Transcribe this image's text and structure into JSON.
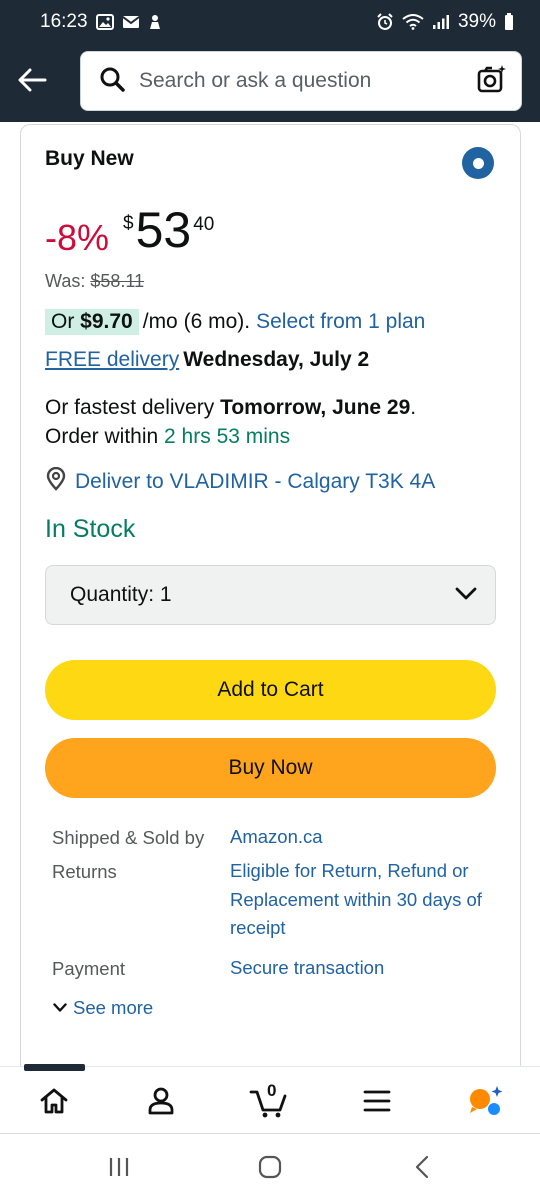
{
  "status_bar": {
    "time": "16:23",
    "battery": "39%"
  },
  "search": {
    "placeholder": "Search or ask a question"
  },
  "buy_box": {
    "title": "Buy New",
    "discount": "-8%",
    "currency": "$",
    "price_whole": "53",
    "price_fraction": "40",
    "was_label": "Was:",
    "was_price": "$58.11",
    "installment_prefix": "Or",
    "installment_amount": "$9.70",
    "installment_suffix": "/mo (6 mo).",
    "installment_link": "Select from 1 plan",
    "free_delivery_link": "FREE delivery",
    "delivery_date": "Wednesday, July 2",
    "fastest_prefix": "Or fastest delivery",
    "fastest_date": "Tomorrow, June 29",
    "fastest_period": ".",
    "order_within_label": "Order within",
    "order_within_time": "2 hrs 53 mins",
    "deliver_to": "Deliver to VLADIMIR - Calgary T3K 4A",
    "stock_status": "In Stock",
    "quantity_label": "Quantity:",
    "quantity_value": "1",
    "add_to_cart": "Add to Cart",
    "buy_now": "Buy Now",
    "shipped_label": "Shipped & Sold by",
    "shipped_value": "Amazon.ca",
    "returns_label": "Returns",
    "returns_value": "Eligible for Return, Refund or Replacement within 30 days of receipt",
    "payment_label": "Payment",
    "payment_value": "Secure transaction",
    "see_more": "See more"
  },
  "bottom_nav": {
    "cart_count": "0"
  },
  "colors": {
    "header_bg": "#1f2a37",
    "link": "#2162a1",
    "discount": "#cc0c39",
    "in_stock": "#067d62",
    "add_to_cart": "#ffd814",
    "buy_now": "#ffa41c"
  }
}
